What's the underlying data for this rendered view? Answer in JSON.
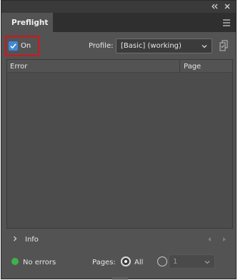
{
  "panel": {
    "tab_label": "Preflight"
  },
  "icons": {
    "collapse": "double-chevron-left-icon",
    "close": "close-icon",
    "panel_menu": "hamburger-menu-icon",
    "profile_define": "define-profiles-icon",
    "expand": "chevron-right-icon",
    "prev": "triangle-left-icon",
    "next": "triangle-right-icon"
  },
  "toolbar": {
    "on_label": "On",
    "on_checked": true,
    "profile_label": "Profile:",
    "profile_value": "[Basic] (working)"
  },
  "table": {
    "columns": [
      "Error",
      "Page"
    ],
    "rows": []
  },
  "info": {
    "label": "Info"
  },
  "status": {
    "text": "No errors",
    "color": "#3fb24a"
  },
  "pages": {
    "label": "Pages:",
    "all_label": "All",
    "all_selected": true,
    "range_value": "1"
  },
  "colors": {
    "highlight": "#d6131a",
    "checkbox": "#3f88d8",
    "panel_bg": "#535353"
  }
}
